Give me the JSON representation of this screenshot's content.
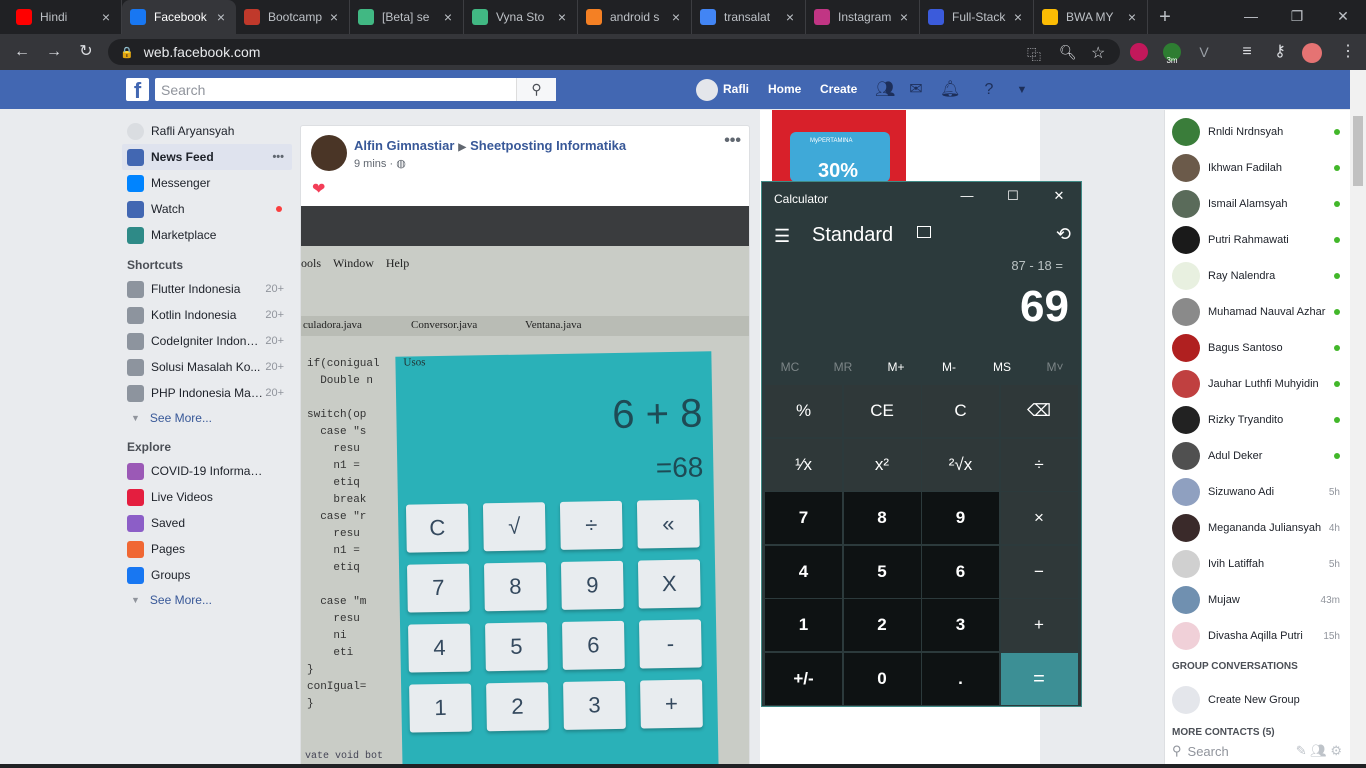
{
  "browser": {
    "tabs": [
      {
        "label": "Hindi",
        "icon": "youtube-icon",
        "color": "#ff0000"
      },
      {
        "label": "Facebook",
        "icon": "facebook-icon",
        "color": "#1877f2",
        "active": true
      },
      {
        "label": "Bootcamp",
        "icon": "bootcamp-icon",
        "color": "#c0392b"
      },
      {
        "label": "[Beta] se",
        "icon": "vue-icon",
        "color": "#41b883"
      },
      {
        "label": "Vyna Sto",
        "icon": "vue-icon",
        "color": "#41b883"
      },
      {
        "label": "android s",
        "icon": "stackoverflow-icon",
        "color": "#f48024"
      },
      {
        "label": "transalat",
        "icon": "google-icon",
        "color": "#4285f4"
      },
      {
        "label": "Instagram",
        "icon": "instagram-icon",
        "color": "#c13584"
      },
      {
        "label": "Full-Stack",
        "icon": "fullstack-icon",
        "color": "#3b5bdb"
      },
      {
        "label": "BWA MY",
        "icon": "google-drive-icon",
        "color": "#fbbc04"
      }
    ],
    "url": "web.facebook.com",
    "ext_badge": "3m"
  },
  "fb": {
    "search_placeholder": "Search",
    "user": "Rafli",
    "nav": [
      "Home",
      "Create"
    ]
  },
  "leftnav": {
    "profile": "Rafli Aryansyah",
    "main": [
      {
        "label": "News Feed",
        "color": "#4267b2"
      },
      {
        "label": "Messenger",
        "color": "#0084ff"
      },
      {
        "label": "Watch",
        "color": "#4267b2"
      },
      {
        "label": "Marketplace",
        "color": "#2e8a87"
      }
    ],
    "shortcuts_title": "Shortcuts",
    "shortcuts": [
      {
        "label": "Flutter Indonesia",
        "count": "20+"
      },
      {
        "label": "Kotlin Indonesia",
        "count": "20+"
      },
      {
        "label": "CodeIgniter Indone...",
        "count": "20+"
      },
      {
        "label": "Solusi Masalah Ko...",
        "count": "20+"
      },
      {
        "label": "PHP Indonesia Mar...",
        "count": "20+"
      }
    ],
    "see_more": "See More...",
    "explore_title": "Explore",
    "explore": [
      {
        "label": "COVID-19 Informat...",
        "color": "#9b59b6"
      },
      {
        "label": "Live Videos",
        "color": "#e41e3f"
      },
      {
        "label": "Saved",
        "color": "#8c5ec7"
      },
      {
        "label": "Pages",
        "color": "#f06733"
      },
      {
        "label": "Groups",
        "color": "#1877f2"
      }
    ]
  },
  "post": {
    "author": "Alfin Gimnastiar",
    "group": "Sheetposting Informatika",
    "time": "9 mins ·",
    "photo": {
      "menu": [
        "ools",
        "Window",
        "Help"
      ],
      "tabs": [
        "culadora.java",
        "Conversor.java",
        "Ventana.java"
      ],
      "code": [
        "if(conigual",
        "  Double n",
        "",
        "switch(op",
        "  case \"s",
        "    resu",
        "    n1 =",
        "    etiq",
        "    break",
        "  case \"r",
        "    resu",
        "    n1 =",
        "    etiq",
        "",
        "  case \"m",
        "    resu",
        "    ni",
        "    eti",
        "}",
        "conIgual=",
        "}"
      ],
      "phone_title": "Usos",
      "expression": "6 + 8",
      "result": "=68",
      "keys": [
        "C",
        "√",
        "÷",
        "«",
        "7",
        "8",
        "9",
        "X",
        "4",
        "5",
        "6",
        "-",
        "1",
        "2",
        "3",
        "+"
      ],
      "footer": "vate void bot"
    }
  },
  "ad": {
    "brand": "MyPERTAMINA",
    "percent": "30%"
  },
  "calculator": {
    "title": "Calculator",
    "mode": "Standard",
    "expression": "87 - 18 =",
    "display": "69",
    "memory": [
      "MC",
      "MR",
      "M+",
      "M-",
      "MS",
      "M˅"
    ],
    "keys": [
      [
        "%",
        "CE",
        "C",
        "⌫"
      ],
      [
        "¹⁄x",
        "x²",
        "²√x",
        "÷"
      ],
      [
        "7",
        "8",
        "9",
        "×"
      ],
      [
        "4",
        "5",
        "6",
        "−"
      ],
      [
        "1",
        "2",
        "3",
        "+"
      ],
      [
        "+/-",
        "0",
        ".",
        "="
      ]
    ]
  },
  "chat": {
    "contacts": [
      {
        "name": "Rnldi Nrdnsyah",
        "status": "online",
        "color": "#3a7d3a"
      },
      {
        "name": "Ikhwan Fadilah",
        "status": "online",
        "color": "#6b5a4a"
      },
      {
        "name": "Ismail Alamsyah",
        "status": "online",
        "color": "#5a6b5a"
      },
      {
        "name": "Putri Rahmawati",
        "status": "online",
        "color": "#1a1a1a"
      },
      {
        "name": "Ray Nalendra",
        "status": "online",
        "color": "#e8f0e0"
      },
      {
        "name": "Muhamad Nauval Azhar",
        "status": "online",
        "color": "#8a8a8a"
      },
      {
        "name": "Bagus Santoso",
        "status": "online",
        "color": "#b02020"
      },
      {
        "name": "Jauhar Luthfi Muhyidin",
        "status": "online",
        "color": "#c04040"
      },
      {
        "name": "Rizky Tryandito",
        "status": "online",
        "color": "#222222"
      },
      {
        "name": "Adul Deker",
        "status": "online",
        "color": "#505050"
      },
      {
        "name": "Sizuwano Adi",
        "status": "5h",
        "color": "#8fa0c0"
      },
      {
        "name": "Meganandа Juliansyah",
        "status": "4h",
        "color": "#3a2a2a"
      },
      {
        "name": "Ivih Latiffah",
        "status": "5h",
        "color": "#d0d0d0"
      },
      {
        "name": "Mujaw",
        "status": "43m",
        "color": "#7090b0"
      },
      {
        "name": "Divasha Aqilla Putri",
        "status": "15h",
        "color": "#f0d0d8"
      }
    ],
    "group_title": "GROUP CONVERSATIONS",
    "create_group": "Create New Group",
    "more_title": "MORE CONTACTS (5)",
    "search_placeholder": "Search"
  }
}
